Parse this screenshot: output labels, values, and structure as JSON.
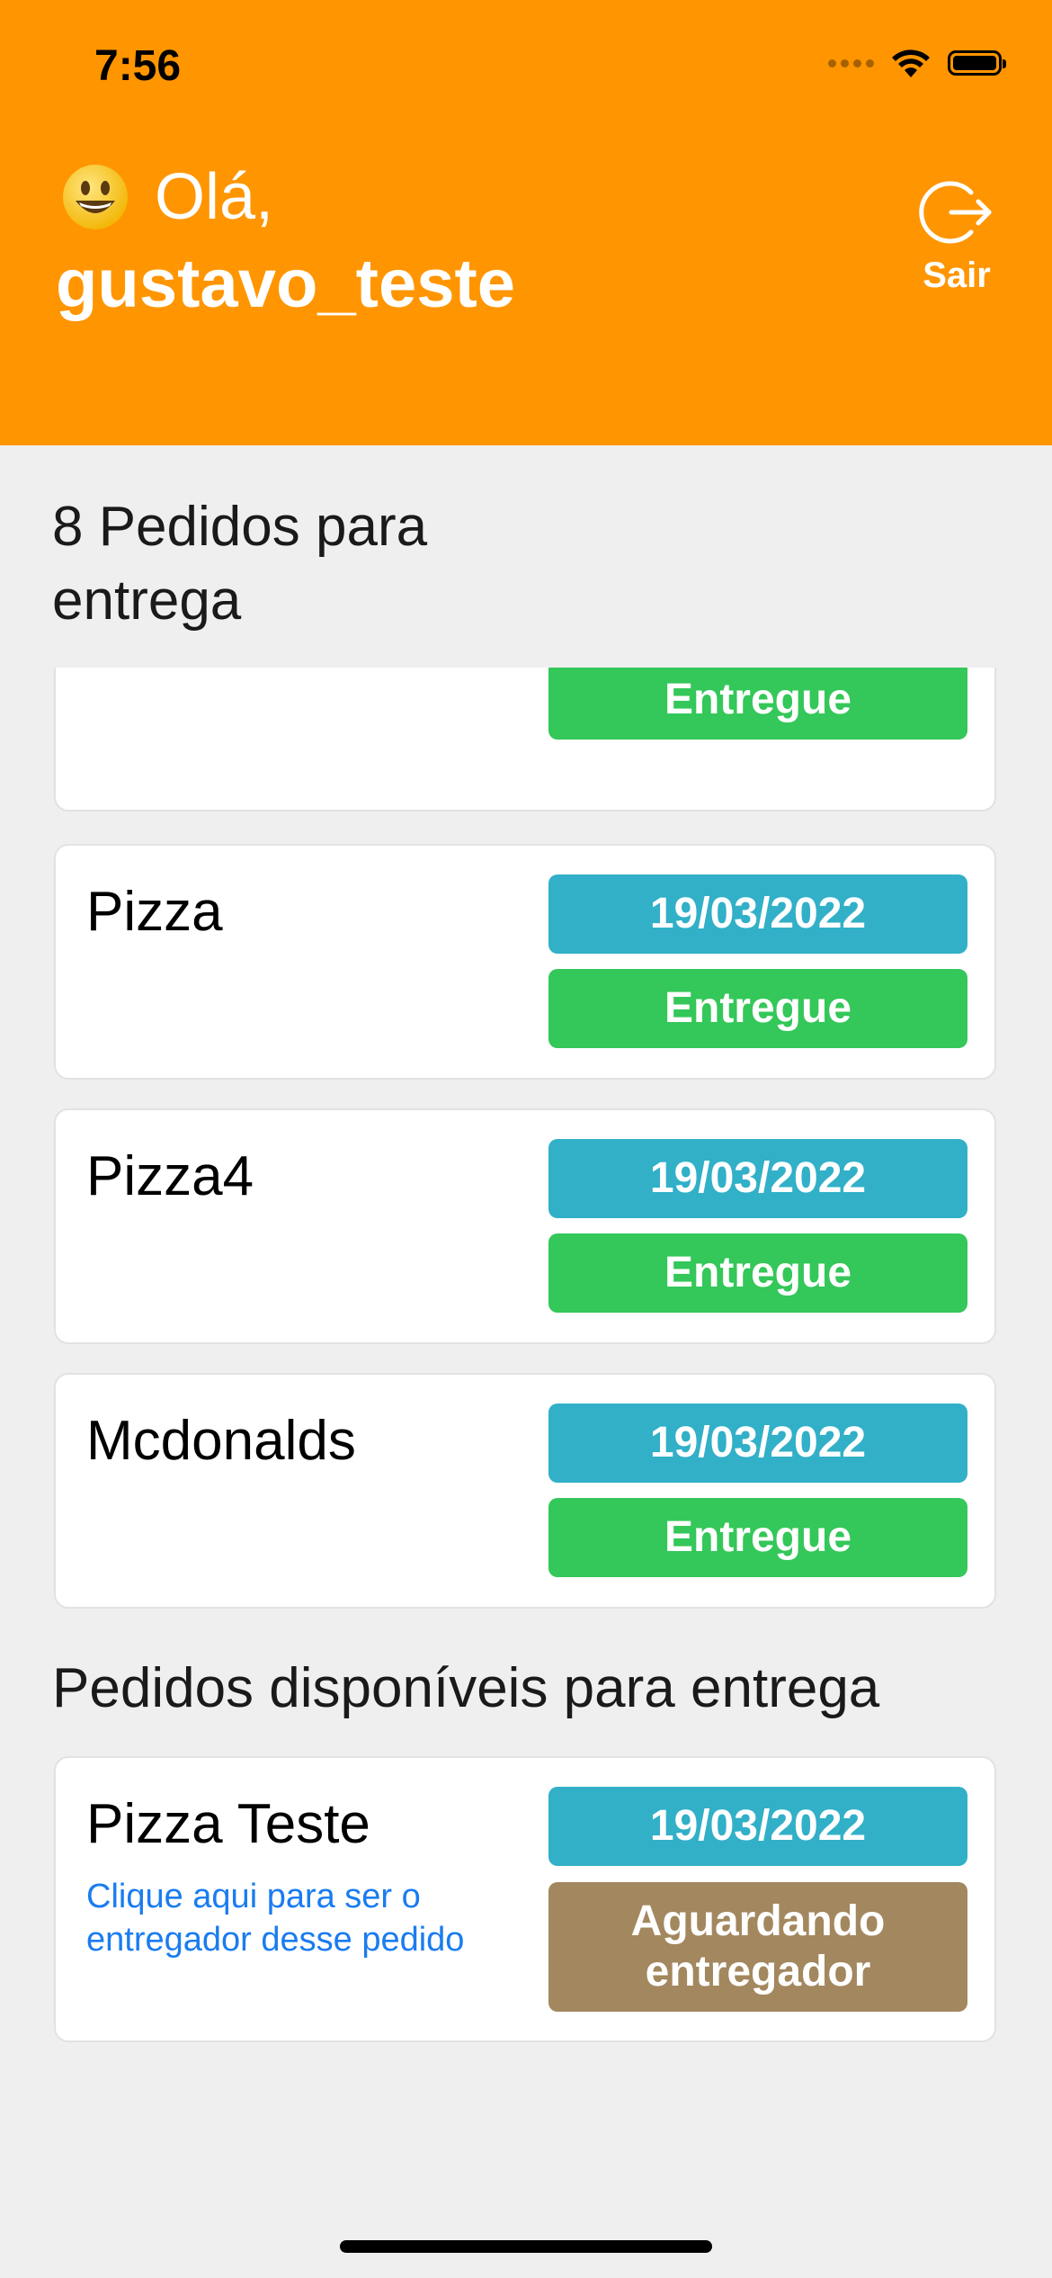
{
  "status_bar": {
    "time": "7:56"
  },
  "header": {
    "greeting": "Olá,",
    "username": "gustavo_teste",
    "logout_label": "Sair",
    "background_color": "#ff9500"
  },
  "my_orders": {
    "title": "8 Pedidos para entrega",
    "items": [
      {
        "name": "",
        "date": "",
        "status": "Entregue"
      },
      {
        "name": "Pizza",
        "date": "19/03/2022",
        "status": "Entregue"
      },
      {
        "name": "Pizza4",
        "date": "19/03/2022",
        "status": "Entregue"
      },
      {
        "name": "Mcdonalds",
        "date": "19/03/2022",
        "status": "Entregue"
      }
    ]
  },
  "available_orders": {
    "title": "Pedidos disponíveis para entrega",
    "items": [
      {
        "name": "Pizza Teste",
        "date": "19/03/2022",
        "status": "Aguardando entregador",
        "action_link": "Clique aqui para ser o entregador desse pedido"
      }
    ]
  },
  "colors": {
    "date_badge": "#31b0c8",
    "delivered_badge": "#34c759",
    "waiting_badge": "#a3875e",
    "link": "#1a7cf0"
  }
}
